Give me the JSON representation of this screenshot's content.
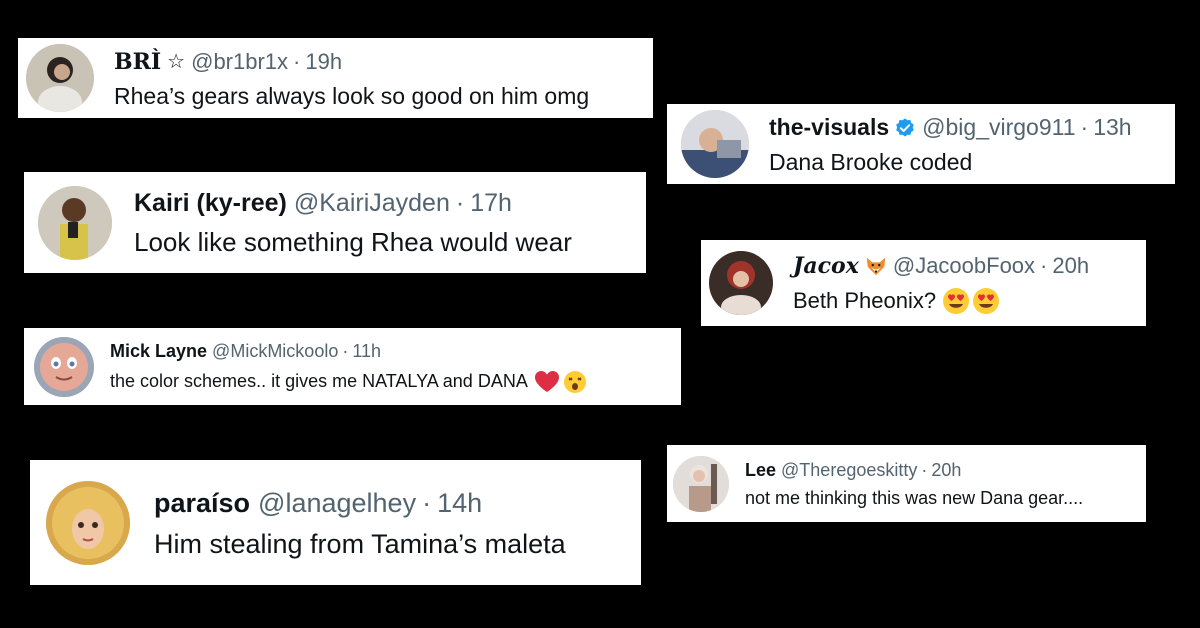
{
  "tweets": [
    {
      "name": "BRÌ",
      "handle": "@br1br1x",
      "time": "19h",
      "text": "Rhea’s gears always look so good on him omg"
    },
    {
      "name": "the-visuals",
      "handle": "@big_virgo911",
      "time": "13h",
      "text": "Dana Brooke coded"
    },
    {
      "name": "Kairi (ky-ree)",
      "handle": "@KairiJayden",
      "time": "17h",
      "text": "Look like something Rhea would wear"
    },
    {
      "name": "Jacox",
      "handle": "@JacoobFoox",
      "time": "20h",
      "text": "Beth Pheonix?"
    },
    {
      "name": "Mick Layne",
      "handle": "@MickMickoolo",
      "time": "11h",
      "text": "the color schemes.. it gives me NATALYA and DANA"
    },
    {
      "name": "Lee",
      "handle": "@Theregoeskitty",
      "time": "20h",
      "text": "not me thinking this was new Dana gear...."
    },
    {
      "name": "paraíso",
      "handle": "@lanagelhey",
      "time": "14h",
      "text": "Him stealing from Tamina’s maleta"
    }
  ],
  "separator": "·",
  "colors": {
    "background": "#000000",
    "name": "#0f1419",
    "meta": "#536471",
    "verified": "#1d9bf0"
  }
}
